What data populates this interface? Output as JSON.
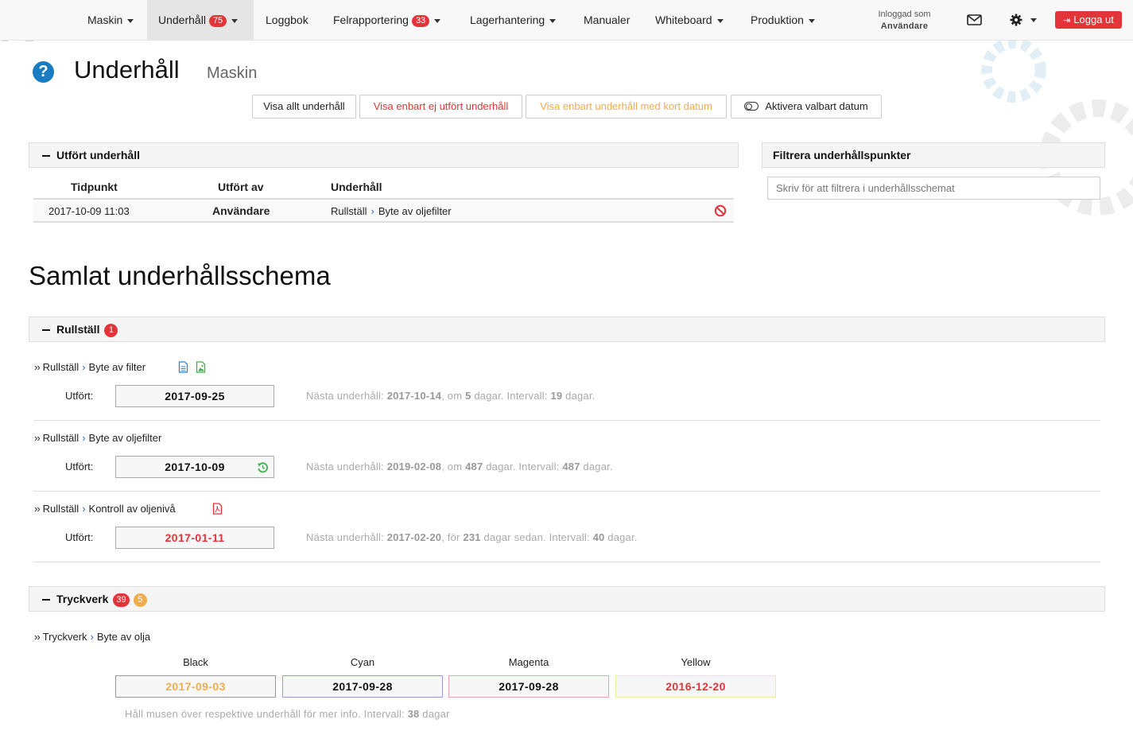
{
  "colors": {
    "accent_red": "#e3343a",
    "accent_orange": "#f0ad4e",
    "link_blue": "#2a6ebb",
    "green": "#3cb04a"
  },
  "nav": {
    "items": [
      {
        "label": "Maskin",
        "dropdown": true
      },
      {
        "label": "Underhåll",
        "badge": "75",
        "dropdown": true,
        "active": true
      },
      {
        "label": "Loggbok"
      },
      {
        "label": "Felrapportering",
        "badge": "33",
        "dropdown": true
      },
      {
        "label": "Lagerhantering",
        "dropdown": true
      },
      {
        "label": "Manualer"
      },
      {
        "label": "Whiteboard",
        "dropdown": true
      },
      {
        "label": "Produktion",
        "dropdown": true
      }
    ],
    "logged_in_label": "Inloggad som",
    "user": "Användare",
    "logout": "Logga ut",
    "icons": [
      "mail-icon",
      "gear-icon"
    ]
  },
  "header": {
    "title": "Underhåll",
    "subtitle": "Maskin"
  },
  "filter_buttons": [
    {
      "label": "Visa allt underhåll"
    },
    {
      "label": "Visa enbart ej utfört underhåll"
    },
    {
      "label": "Visa enbart underhåll med kort datum"
    },
    {
      "label": "Aktivera valbart datum"
    }
  ],
  "performed": {
    "title": "Utfört underhåll",
    "columns": [
      "Tidpunkt",
      "Utfört av",
      "Underhåll"
    ],
    "rows": [
      {
        "time": "2017-10-09 11:03",
        "by": "Användare",
        "group": "Rullställ",
        "task": "Byte av oljefilter"
      }
    ]
  },
  "filter_panel": {
    "title": "Filtrera underhållspunkter",
    "placeholder": "Skriv för att filtrera i underhållsschemat"
  },
  "schedule": {
    "title": "Samlat underhållsschema",
    "done_label": "Utfört:",
    "next_label": "Nästa underhåll:",
    "interval_label": "Intervall:",
    "days_label": "dagar.",
    "groups": [
      {
        "name": "Rullställ",
        "badge_red": "1",
        "items": [
          {
            "group": "Rullställ",
            "task": "Byte av filter",
            "date": "2017-09-25",
            "next": "2017-10-14",
            "rel_prefix": ", om",
            "days": "5",
            "rel_suffix": "dagar.",
            "interval": "19"
          },
          {
            "group": "Rullställ",
            "task": "Byte av oljefilter",
            "date": "2017-10-09",
            "next": "2019-02-08",
            "rel_prefix": ", om",
            "days": "487",
            "rel_suffix": "dagar.",
            "interval": "487"
          },
          {
            "group": "Rullställ",
            "task": "Kontroll av oljenivå",
            "date": "2017-01-11",
            "next": "2017-02-20",
            "rel_prefix": ", för",
            "days": "231",
            "rel_suffix": "dagar sedan.",
            "interval": "40"
          }
        ]
      },
      {
        "name": "Tryckverk",
        "badge_red": "39",
        "badge_orange": "5",
        "items": [
          {
            "group": "Tryckverk",
            "task": "Byte av olja",
            "colors": [
              {
                "name": "Black",
                "date": "2017-09-03"
              },
              {
                "name": "Cyan",
                "date": "2017-09-28"
              },
              {
                "name": "Magenta",
                "date": "2017-09-28"
              },
              {
                "name": "Yellow",
                "date": "2016-12-20"
              }
            ],
            "hint": "Håll musen över respektive underhåll för mer info. Intervall:",
            "interval": "38",
            "interval_unit": "dagar"
          }
        ]
      }
    ]
  }
}
